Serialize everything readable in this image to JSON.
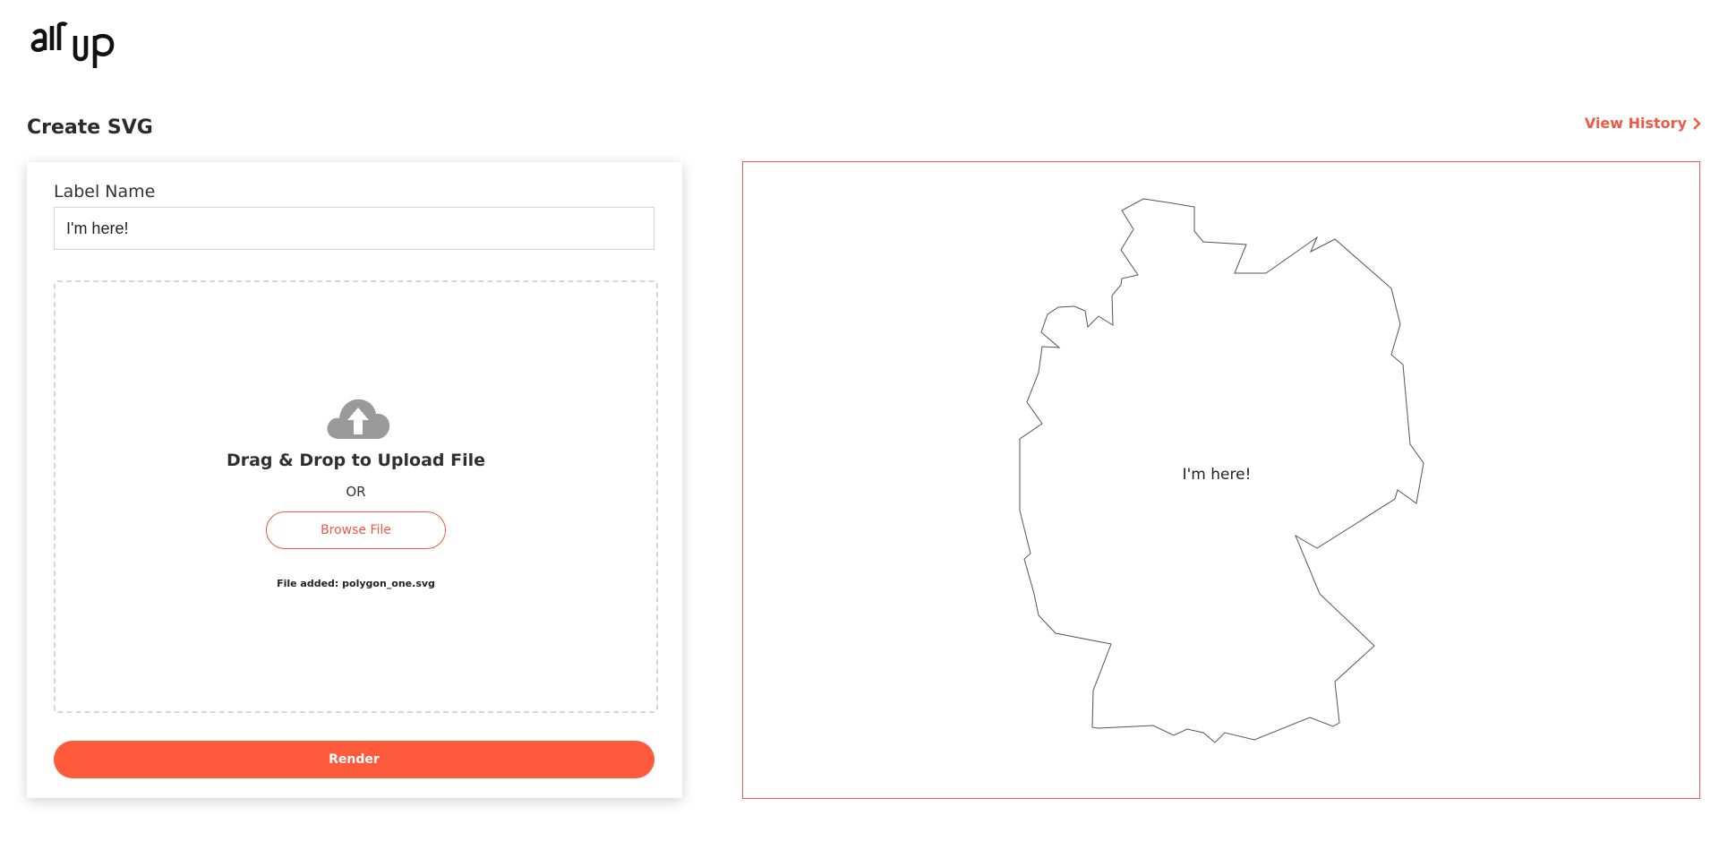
{
  "brand": {
    "logo_text": "airup"
  },
  "header": {
    "page_title": "Create SVG",
    "view_history_label": "View History",
    "accent_color": "#f05a45"
  },
  "form": {
    "label_field_caption": "Label Name",
    "label_value": "I'm here!",
    "dropzone": {
      "icon": "cloud-upload-icon",
      "title": "Drag & Drop to Upload File",
      "or_text": "OR",
      "browse_label": "Browse File",
      "file_added_text": "File added: polygon_one.svg"
    },
    "render_label": "Render",
    "render_color": "#ff5a3c"
  },
  "preview": {
    "label_text": "I'm here!",
    "shape": "polygon"
  }
}
